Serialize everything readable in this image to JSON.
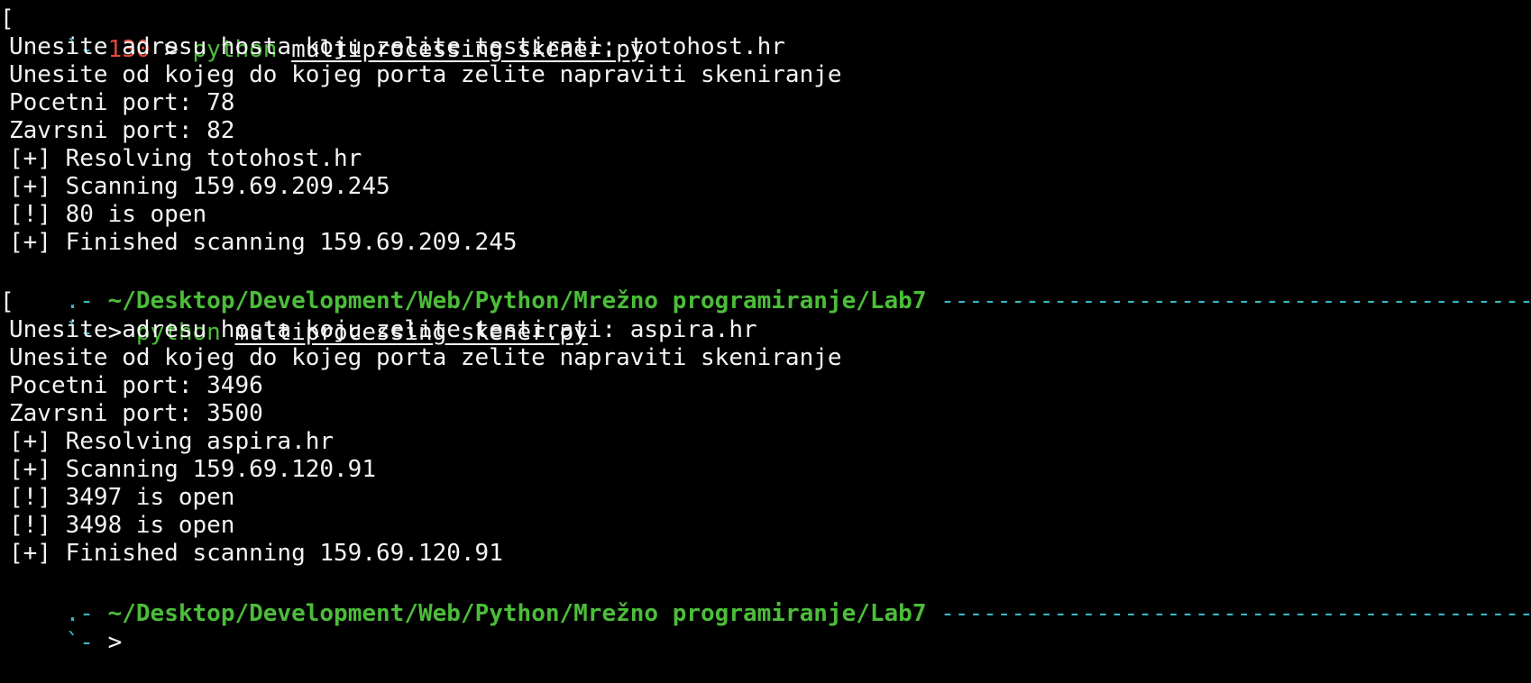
{
  "terminal": {
    "colors": {
      "background": "#000000",
      "text": "#f4f4f4",
      "prompt_cyan": "#38b8c8",
      "exit_code_red": "#e0483a",
      "command_green": "#4cbd3a"
    },
    "session1": {
      "prompt_prefix": "`- ",
      "exit_code": "130",
      "prompt_arrow": " > ",
      "command": "python",
      "script": "multiprocessing_skener.py",
      "output": [
        "Unesite adresu hosta koju zelite testirati: totohost.hr",
        "Unesite od kojeg do kojeg porta zelite napraviti skeniranje",
        "Pocetni port: 78",
        "Zavrsni port: 82",
        "[+] Resolving totohost.hr",
        "[+] Scanning 159.69.209.245",
        "[!] 80 is open",
        "[+] Finished scanning 159.69.209.245"
      ]
    },
    "path_line_1": {
      "lead": ".- ",
      "path": "~/Desktop/Development/Web/Python/Mrežno programiranje/Lab7",
      "dashes": " ------------------------------------------------------------------------------------------------"
    },
    "session2": {
      "prompt_prefix": "`- ",
      "prompt_arrow": "> ",
      "command": "python",
      "script": "multiprocessing_skener.py",
      "output": [
        "Unesite adresu hosta koju zelite testirati: aspira.hr",
        "Unesite od kojeg do kojeg porta zelite napraviti skeniranje",
        "Pocetni port: 3496",
        "Zavrsni port: 3500",
        "[+] Resolving aspira.hr",
        "[+] Scanning 159.69.120.91",
        "[!] 3497 is open",
        "[!] 3498 is open",
        "[+] Finished scanning 159.69.120.91"
      ]
    },
    "path_line_2": {
      "lead": ".- ",
      "path": "~/Desktop/Development/Web/Python/Mrežno programiranje/Lab7",
      "dashes": " ------------------------------------------------------------------------------------------------"
    },
    "final_prompt": {
      "prompt_prefix": "`- ",
      "prompt_arrow": "> "
    }
  }
}
